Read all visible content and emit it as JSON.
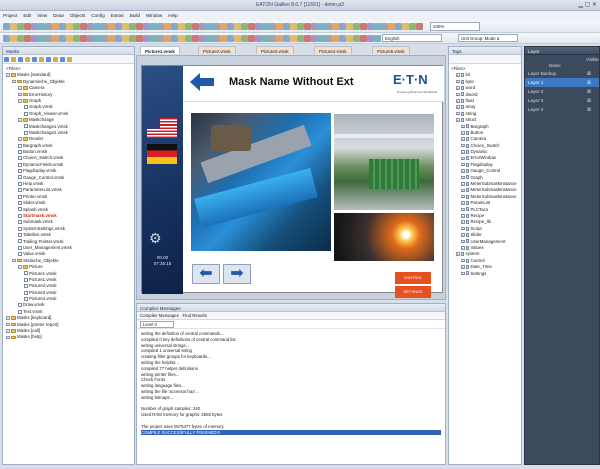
{
  "window": {
    "title": "EATON Galileo 8.0.7 [11691] - demo.p3"
  },
  "menu": [
    "Project",
    "Edit",
    "View",
    "Draw",
    "Objects",
    "Config",
    "Extras",
    "Build",
    "Window",
    "Help"
  ],
  "toolbar": {
    "zoom": "100%",
    "language": "English",
    "unit_group": "Unit Group: Mode a"
  },
  "project_panel": {
    "title": "Masks",
    "root": "<Files>",
    "items": [
      {
        "label": "Masks [standard]",
        "level": 0,
        "type": "folder"
      },
      {
        "label": "Dynamische_Objekte",
        "level": 1,
        "type": "folder"
      },
      {
        "label": "Camera",
        "level": 2,
        "type": "folder"
      },
      {
        "label": "ErrorHistory",
        "level": 2,
        "type": "folder"
      },
      {
        "label": "Graph",
        "level": 2,
        "type": "folder"
      },
      {
        "label": "Graph.vmsk",
        "level": 3,
        "type": "file"
      },
      {
        "label": "Graph_Viewer.vmsk",
        "level": 3,
        "type": "file"
      },
      {
        "label": "Maskchange",
        "level": 2,
        "type": "folder"
      },
      {
        "label": "Maskchange1.vmsk",
        "level": 3,
        "type": "file"
      },
      {
        "label": "Maskchange2.vmsk",
        "level": 3,
        "type": "file"
      },
      {
        "label": "Render",
        "level": 2,
        "type": "folder"
      },
      {
        "label": "Bargraph.vmsk",
        "level": 2,
        "type": "file"
      },
      {
        "label": "Button.vmsk",
        "level": 2,
        "type": "file"
      },
      {
        "label": "Choice_Switch.vmsk",
        "level": 2,
        "type": "file"
      },
      {
        "label": "DynamicFields.vmsk",
        "level": 2,
        "type": "file"
      },
      {
        "label": "Flagdisplay.vmsk",
        "level": 2,
        "type": "file"
      },
      {
        "label": "Gauge_Control.vmsk",
        "level": 2,
        "type": "file"
      },
      {
        "label": "Help.vmsk",
        "level": 2,
        "type": "file"
      },
      {
        "label": "ParameterList.vmsk",
        "level": 2,
        "type": "file"
      },
      {
        "label": "Printer.vmsk",
        "level": 2,
        "type": "file"
      },
      {
        "label": "Slider.vmsk",
        "level": 2,
        "type": "file"
      },
      {
        "label": "Splash.vmsk",
        "level": 2,
        "type": "file"
      },
      {
        "label": "Startmask.vmsk",
        "level": 2,
        "type": "file",
        "highlight": true
      },
      {
        "label": "Submask.vmsk",
        "level": 2,
        "type": "file"
      },
      {
        "label": "SystemSettings.vmsk",
        "level": 2,
        "type": "file"
      },
      {
        "label": "Tabellen.vmsk",
        "level": 2,
        "type": "file"
      },
      {
        "label": "Trailing Pointer.vmsk",
        "level": 2,
        "type": "file"
      },
      {
        "label": "User_Management.vmsk",
        "level": 2,
        "type": "file"
      },
      {
        "label": "Value.vmsk",
        "level": 2,
        "type": "file"
      },
      {
        "label": "Statische_Objekte",
        "level": 1,
        "type": "folder"
      },
      {
        "label": "Picture",
        "level": 2,
        "type": "folder"
      },
      {
        "label": "Picture1.vmsk",
        "level": 3,
        "type": "file"
      },
      {
        "label": "Picture1.vmsk",
        "level": 3,
        "type": "file"
      },
      {
        "label": "Picture2.vmsk",
        "level": 3,
        "type": "file"
      },
      {
        "label": "Picture3.vmsk",
        "level": 3,
        "type": "file"
      },
      {
        "label": "Picture4.vmsk",
        "level": 3,
        "type": "file"
      },
      {
        "label": "Draw.vmsk",
        "level": 2,
        "type": "file"
      },
      {
        "label": "Text.vmsk",
        "level": 2,
        "type": "file"
      },
      {
        "label": "Masks [keyboard]",
        "level": 0,
        "type": "folder"
      },
      {
        "label": "Masks [printer report]",
        "level": 0,
        "type": "folder"
      },
      {
        "label": "Masks [call]",
        "level": 0,
        "type": "folder"
      },
      {
        "label": "Masks [help]",
        "level": 0,
        "type": "folder"
      }
    ]
  },
  "editor_tabs": [
    "Picture1.vmsk",
    "Picture2.vmsk",
    "Picture3.vmsk",
    "Picture4.vmsk",
    "Picture5.vmsk"
  ],
  "canvas": {
    "mask_title": "Mask Name Without Ext",
    "logo": "E·T·N",
    "logo_tagline": "Powering Business Worldwide",
    "btn_a": "CONTROL",
    "btn_b": "SETTINGS",
    "date": "00.00",
    "time": "07:35:15"
  },
  "compiler": {
    "title": "Compiler Messages",
    "tabs": [
      "Compiler Messages",
      "Find Results"
    ],
    "level": "Level 0",
    "lines": [
      "writing the definition of central commands...",
      "  compiled 0 key definitions of central command list",
      "writing universal strings...",
      "  compiled 1 universal string",
      "creating filter groups for keyboards...",
      "writing the helplist...",
      "  compiled 77 helper definitions",
      "writing printer files...",
      "Check Fonts",
      "writing language files...",
      "writing the file 'accessor.hax'...",
      "writing bitmaps...",
      "",
      "Number of graph samples:      240",
      "Used RAM memory for graphs:      2582 bytes",
      "",
      "The project uses 0575477 bytes of memory.",
      "COMPILE SUCCESSFULLY FINISHED!!!"
    ]
  },
  "objects_panel": {
    "title": "Tags",
    "root": "<Files>",
    "items": [
      {
        "label": "bit",
        "level": 1
      },
      {
        "label": "byte",
        "level": 1
      },
      {
        "label": "word",
        "level": 1
      },
      {
        "label": "dword",
        "level": 1
      },
      {
        "label": "float",
        "level": 1
      },
      {
        "label": "array",
        "level": 1
      },
      {
        "label": "string",
        "level": 1
      },
      {
        "label": "struct",
        "level": 1
      },
      {
        "label": "Bargraph",
        "level": 2
      },
      {
        "label": "Button",
        "level": 2
      },
      {
        "label": "Camera",
        "level": 2
      },
      {
        "label": "Choice_Switch",
        "level": 2
      },
      {
        "label": "Dynamic",
        "level": 2
      },
      {
        "label": "ErrorWindow",
        "level": 2
      },
      {
        "label": "Flagdisplay",
        "level": 2
      },
      {
        "label": "Gauge_Control",
        "level": 2
      },
      {
        "label": "Graph",
        "level": 2
      },
      {
        "label": "MeterSubmaskInstance",
        "level": 2
      },
      {
        "label": "MeterSubmaskInstance",
        "level": 2
      },
      {
        "label": "MeterSubmaskInstance",
        "level": 2
      },
      {
        "label": "ParamList",
        "level": 2
      },
      {
        "label": "PLCTacs",
        "level": 2
      },
      {
        "label": "Recipe",
        "level": 2
      },
      {
        "label": "Recipe_lib",
        "level": 2
      },
      {
        "label": "Script",
        "level": 2
      },
      {
        "label": "Slider",
        "level": 2
      },
      {
        "label": "UserManagement",
        "level": 2
      },
      {
        "label": "Values",
        "level": 2
      },
      {
        "label": "system",
        "level": 1
      },
      {
        "label": "Control",
        "level": 2
      },
      {
        "label": "Date_Time",
        "level": 2
      },
      {
        "label": "Settings",
        "level": 2
      }
    ]
  },
  "layers_panel": {
    "title": "Layer",
    "col_name": "Name",
    "col_visible": "Visible",
    "layers": [
      {
        "name": "Layer Backup",
        "visible": true,
        "selected": false
      },
      {
        "name": "Layer 1",
        "visible": true,
        "selected": true
      },
      {
        "name": "Layer 2",
        "visible": true,
        "selected": false
      },
      {
        "name": "Layer 3",
        "visible": true,
        "selected": false
      },
      {
        "name": "Layer 4",
        "visible": true,
        "selected": false
      }
    ]
  }
}
